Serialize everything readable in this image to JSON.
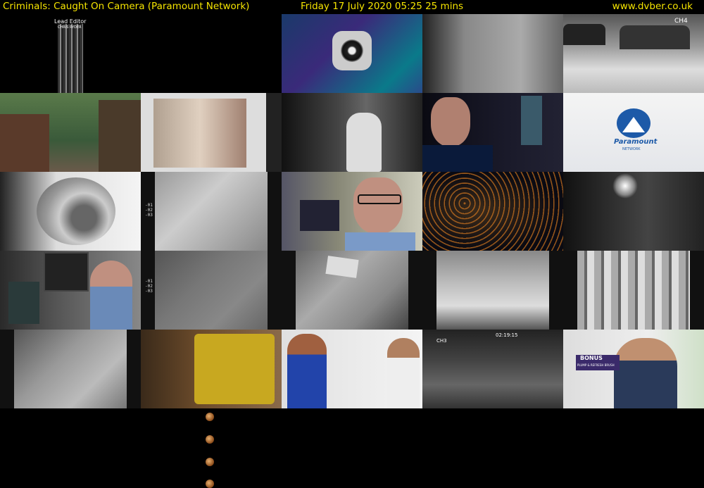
{
  "header": {
    "title": "Criminals: Caught On Camera (Paramount Network)",
    "schedule": "Friday 17 July 2020  05:25  25 mins",
    "site": "www.dvber.co.uk"
  },
  "tiles": {
    "t1": {
      "label": "Lead Editor",
      "sublabel": "CHRIS RYDER"
    },
    "t4": {
      "label": "CH4"
    },
    "t10": {
      "logo_text": "Paramount",
      "logo_sub": "NETWORK"
    },
    "t22": {
      "label": "CH3",
      "timestamp": "02:19:15"
    },
    "t25": {
      "badge": "BONUS",
      "badge_sub": "PLUMP & REFRESH BRUSH"
    }
  },
  "colors": {
    "header_text": "#f5e400",
    "background": "#000000",
    "paramount_blue": "#1d5aa8"
  }
}
